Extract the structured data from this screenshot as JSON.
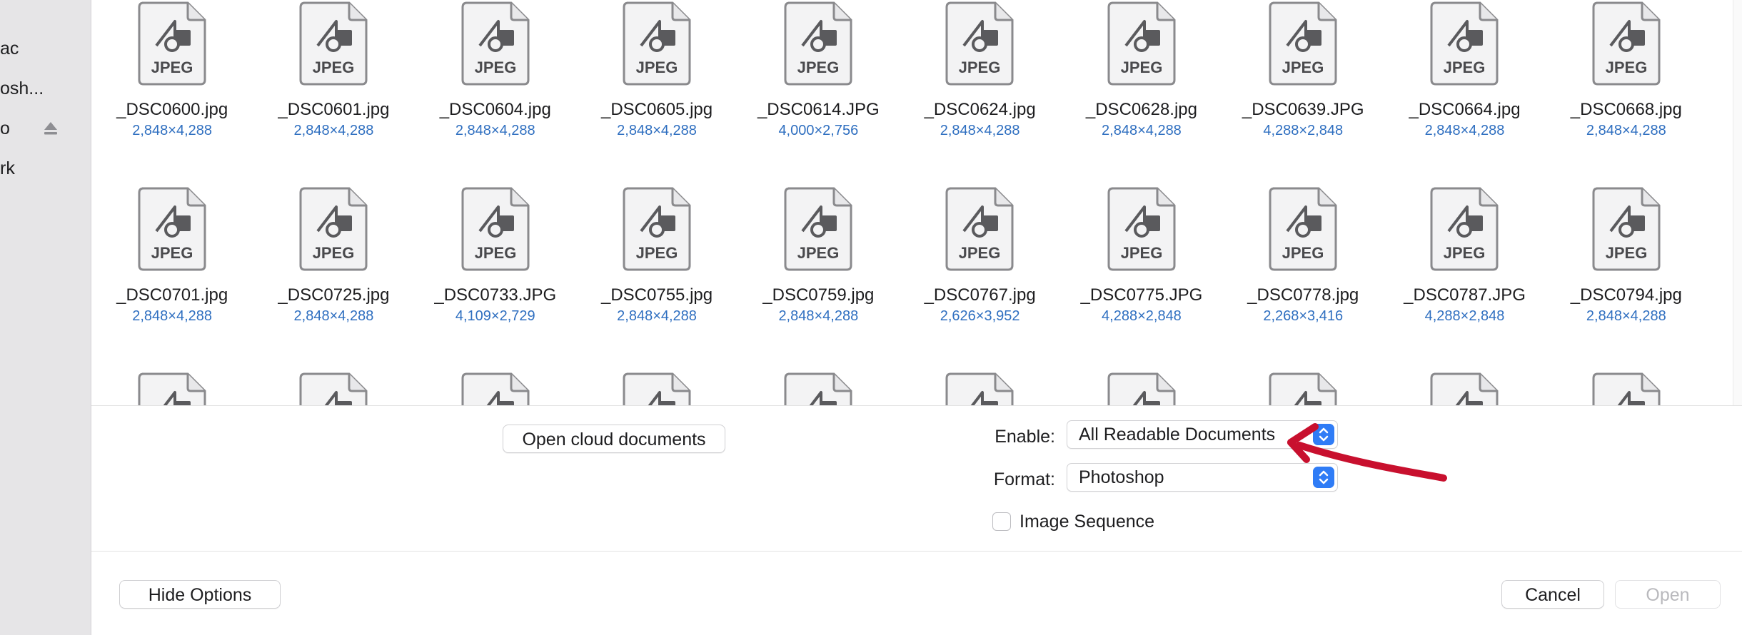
{
  "sidebar": {
    "items": [
      {
        "label": "ac"
      },
      {
        "label": "osh..."
      },
      {
        "label": "o"
      },
      {
        "label": "rk"
      }
    ]
  },
  "files": [
    {
      "name": "_DSC0600.jpg",
      "dims": "2,848×4,288",
      "badge": "JPEG"
    },
    {
      "name": "_DSC0601.jpg",
      "dims": "2,848×4,288",
      "badge": "JPEG"
    },
    {
      "name": "_DSC0604.jpg",
      "dims": "2,848×4,288",
      "badge": "JPEG"
    },
    {
      "name": "_DSC0605.jpg",
      "dims": "2,848×4,288",
      "badge": "JPEG"
    },
    {
      "name": "_DSC0614.JPG",
      "dims": "4,000×2,756",
      "badge": "JPEG"
    },
    {
      "name": "_DSC0624.jpg",
      "dims": "2,848×4,288",
      "badge": "JPEG"
    },
    {
      "name": "_DSC0628.jpg",
      "dims": "2,848×4,288",
      "badge": "JPEG"
    },
    {
      "name": "_DSC0639.JPG",
      "dims": "4,288×2,848",
      "badge": "JPEG"
    },
    {
      "name": "_DSC0664.jpg",
      "dims": "2,848×4,288",
      "badge": "JPEG"
    },
    {
      "name": "_DSC0668.jpg",
      "dims": "2,848×4,288",
      "badge": "JPEG"
    },
    {
      "name": "_DSC0701.jpg",
      "dims": "2,848×4,288",
      "badge": "JPEG"
    },
    {
      "name": "_DSC0725.jpg",
      "dims": "2,848×4,288",
      "badge": "JPEG"
    },
    {
      "name": "_DSC0733.JPG",
      "dims": "4,109×2,729",
      "badge": "JPEG"
    },
    {
      "name": "_DSC0755.jpg",
      "dims": "2,848×4,288",
      "badge": "JPEG"
    },
    {
      "name": "_DSC0759.jpg",
      "dims": "2,848×4,288",
      "badge": "JPEG"
    },
    {
      "name": "_DSC0767.jpg",
      "dims": "2,626×3,952",
      "badge": "JPEG"
    },
    {
      "name": "_DSC0775.JPG",
      "dims": "4,288×2,848",
      "badge": "JPEG"
    },
    {
      "name": "_DSC0778.jpg",
      "dims": "2,268×3,416",
      "badge": "JPEG"
    },
    {
      "name": "_DSC0787.JPG",
      "dims": "4,288×2,848",
      "badge": "JPEG"
    },
    {
      "name": "_DSC0794.jpg",
      "dims": "2,848×4,288",
      "badge": "JPEG"
    },
    {
      "name": "",
      "dims": "",
      "badge": "JPEG"
    },
    {
      "name": "",
      "dims": "",
      "badge": "JPEG"
    },
    {
      "name": "",
      "dims": "",
      "badge": "JPEG"
    },
    {
      "name": "",
      "dims": "",
      "badge": "JPEG"
    },
    {
      "name": "",
      "dims": "",
      "badge": "JPEG"
    },
    {
      "name": "",
      "dims": "",
      "badge": "JPEG"
    },
    {
      "name": "",
      "dims": "",
      "badge": "JPEG"
    },
    {
      "name": "",
      "dims": "",
      "badge": "JPEG"
    },
    {
      "name": "",
      "dims": "",
      "badge": "JPEG"
    },
    {
      "name": "",
      "dims": "",
      "badge": "JPEG"
    }
  ],
  "options": {
    "cloud_button": "Open cloud documents",
    "enable_label": "Enable:",
    "enable_value": "All Readable Documents",
    "format_label": "Format:",
    "format_value": "Photoshop",
    "image_sequence_label": "Image Sequence",
    "image_sequence_checked": false
  },
  "footer": {
    "hide_options": "Hide Options",
    "cancel": "Cancel",
    "open": "Open"
  },
  "colors": {
    "accent": "#2f7cf6",
    "dims_text": "#2f6fc0",
    "annotation": "#c8102e"
  }
}
